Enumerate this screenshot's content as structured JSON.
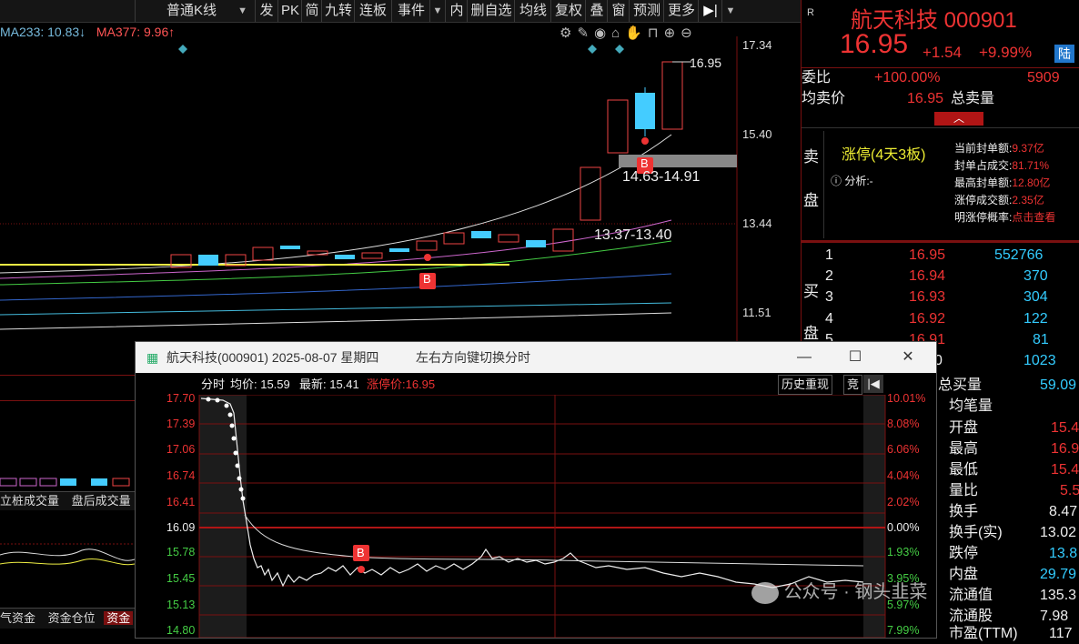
{
  "toolbar": {
    "kline_type": "普通K线",
    "items": [
      "发",
      "PK",
      "简",
      "九转",
      "连板",
      "事件",
      "内",
      "删自选",
      "均线",
      "复权",
      "叠",
      "窗",
      "预测",
      "更多"
    ]
  },
  "ma": {
    "ma233": "MA233: 10.83",
    "ma377": "MA377: 9.96"
  },
  "price_axis": [
    "17.34",
    "15.40",
    "13.44",
    "11.51"
  ],
  "annotations": {
    "high": "16.95",
    "zone1": "14.63-14.91",
    "zone2": "13.37-13.40",
    "b_marker": "B"
  },
  "bottom_labels": [
    "立桩成交量",
    "盘后成交量"
  ],
  "bottom_tabs": [
    "气资金",
    "资金仓位",
    "资金"
  ],
  "stock": {
    "name": "航天科技 000901",
    "price": "16.95",
    "change": "+1.54",
    "pct": "+9.99%",
    "lu_badge": "陆",
    "r_label": "R"
  },
  "ratio": {
    "weibi_label": "委比",
    "weibi_val": "+100.00%",
    "weibi_num": "5909",
    "junmaijia_label": "均卖价",
    "junmaijia_val": "16.95",
    "zongmailiang_label": "总卖量"
  },
  "sell_panel": {
    "side_label_1": "卖",
    "side_label_2": "盘",
    "limit_up": "涨停(4天3板)",
    "analysis": "分析:-",
    "stats": [
      {
        "k": "当前封单额:",
        "v": "9.37亿"
      },
      {
        "k": "封单占成交:",
        "v": "81.71%"
      },
      {
        "k": "最高封单额:",
        "v": "12.80亿"
      },
      {
        "k": "涨停成交额:",
        "v": "2.35亿"
      },
      {
        "k": "明涨停概率:",
        "v": "点击查看"
      }
    ]
  },
  "buy_panel": {
    "side_label_1": "买",
    "side_label_2": "盘",
    "rows": [
      {
        "n": "1",
        "p": "16.95",
        "v": "552766"
      },
      {
        "n": "2",
        "p": "16.94",
        "v": "370"
      },
      {
        "n": "3",
        "p": "16.93",
        "v": "304"
      },
      {
        "n": "4",
        "p": "16.92",
        "v": "122"
      },
      {
        "n": "5",
        "p": "16.91",
        "v": "81"
      },
      {
        "n": "0",
        "p": "",
        "v": "1023"
      }
    ]
  },
  "stats_list": [
    {
      "k": "总买量",
      "v": "59.09"
    },
    {
      "k": "均笔量",
      "v": ""
    },
    {
      "k": "开盘",
      "v": "15.4"
    },
    {
      "k": "最高",
      "v": "16.9"
    },
    {
      "k": "最低",
      "v": "15.4"
    },
    {
      "k": "量比",
      "v": "5.5"
    },
    {
      "k": "换手",
      "v": "8.47"
    },
    {
      "k": "换手(实)",
      "v": "13.02"
    },
    {
      "k": "跌停",
      "v": "13.8"
    },
    {
      "k": "内盘",
      "v": "29.79"
    },
    {
      "k": "流通值",
      "v": "135.3"
    },
    {
      "k": "流通股",
      "v": "7.98"
    },
    {
      "k": "市盈(TTM)",
      "v": "117"
    }
  ],
  "popup": {
    "title": "航天科技(000901) 2025-08-07 星期四",
    "hint": "左右方向键切换分时",
    "fenshi": "分时",
    "avg_label": "均价: 15.59",
    "last_label": "最新: 15.41",
    "limit_label": "涨停价:16.95",
    "history_btn": "历史重现",
    "jing_btn": "竞",
    "left_axis": [
      "17.70",
      "17.39",
      "17.06",
      "16.74",
      "16.41",
      "16.09",
      "15.78",
      "15.45",
      "15.13",
      "14.80"
    ],
    "right_axis": [
      "10.01%",
      "8.08%",
      "6.06%",
      "4.04%",
      "2.02%",
      "0.00%",
      "1.93%",
      "3.95%",
      "5.97%",
      "7.99%"
    ],
    "b_marker": "B"
  },
  "watermark": "公众号 · 钢头韭菜"
}
